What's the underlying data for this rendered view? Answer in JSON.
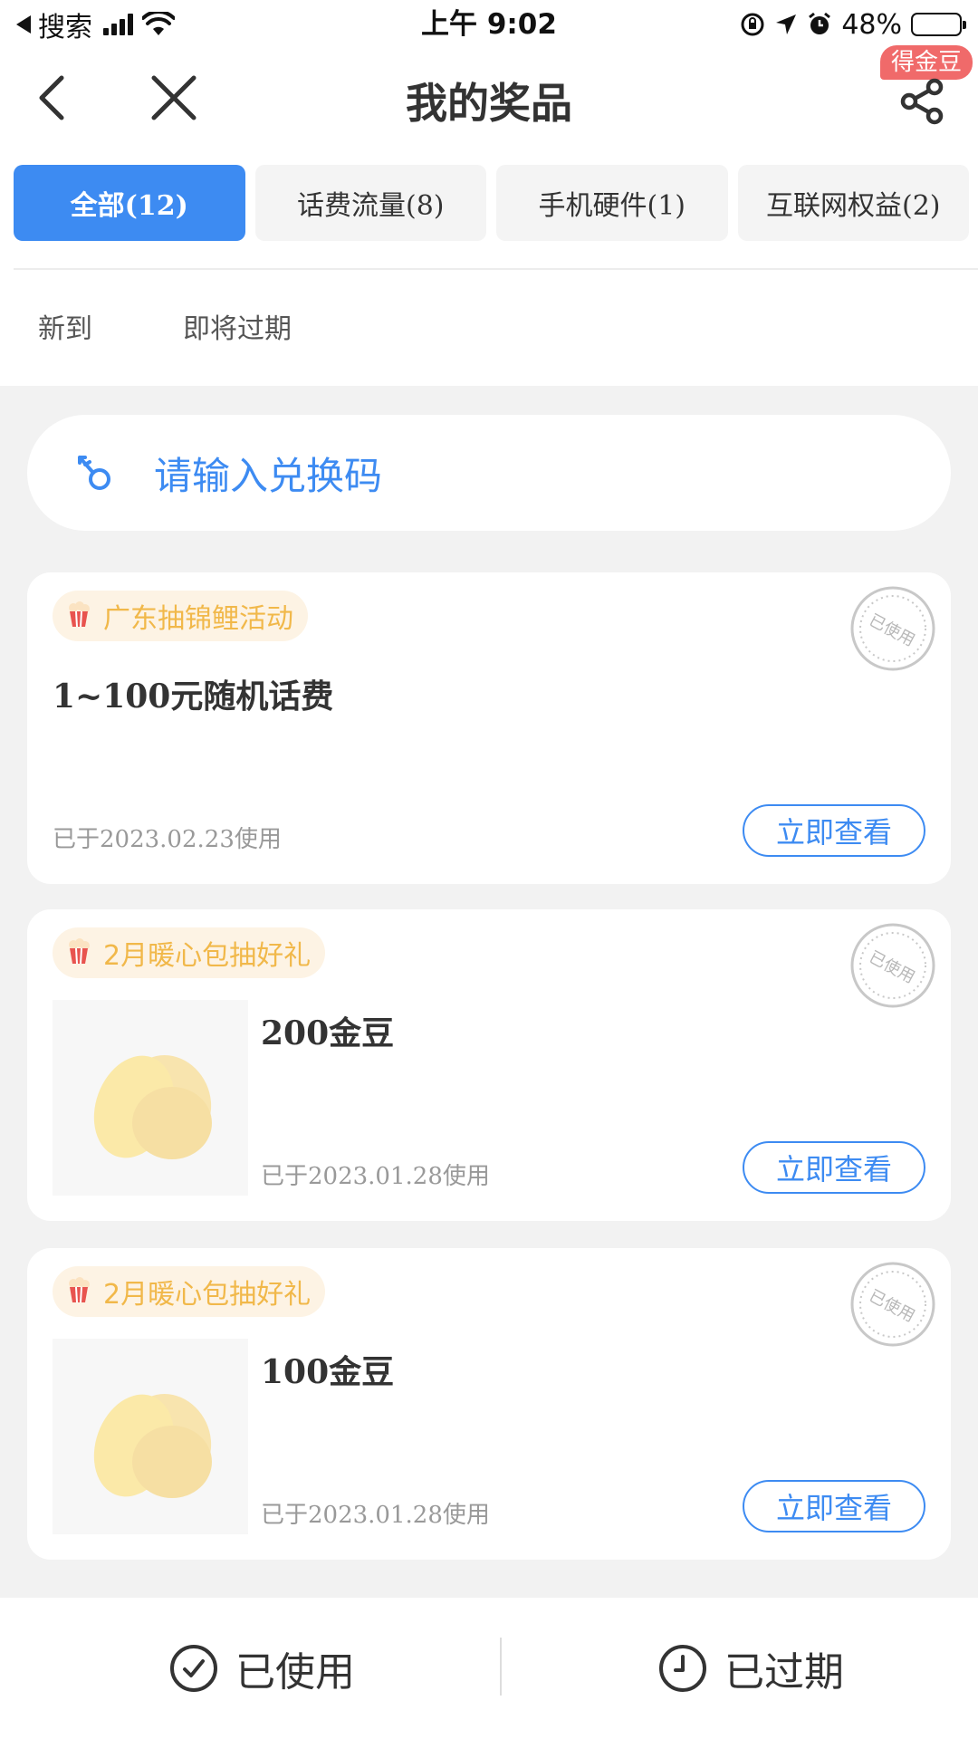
{
  "status_bar": {
    "back_app": "搜索",
    "time": "上午 9:02",
    "battery": "48%"
  },
  "nav": {
    "title": "我的奖品",
    "badge": "得金豆"
  },
  "category_tabs": [
    {
      "label": "全部(12)",
      "active": true
    },
    {
      "label": "话费流量(8)",
      "active": false
    },
    {
      "label": "手机硬件(1)",
      "active": false
    },
    {
      "label": "互联网权益(2)",
      "active": false
    }
  ],
  "sub_tabs": [
    "新到",
    "即将过期"
  ],
  "redeem": {
    "placeholder": "请输入兑换码"
  },
  "prizes": [
    {
      "tag": "广东抽锦鲤活动",
      "title": "1~100元随机话费",
      "date": "已于2023.02.23使用",
      "button": "立即查看",
      "stamp": "已使用"
    },
    {
      "tag": "2月暖心包抽好礼",
      "title": "200金豆",
      "date": "已于2023.01.28使用",
      "button": "立即查看",
      "stamp": "已使用"
    },
    {
      "tag": "2月暖心包抽好礼",
      "title": "100金豆",
      "date": "已于2023.01.28使用",
      "button": "立即查看",
      "stamp": "已使用"
    }
  ],
  "bottom_bar": {
    "used": "已使用",
    "expired": "已过期"
  },
  "colors": {
    "accent": "#3d8bf2",
    "tag_text": "#f1b84a",
    "tag_bg": "#fdf3e4",
    "badge": "#f06a6a"
  }
}
